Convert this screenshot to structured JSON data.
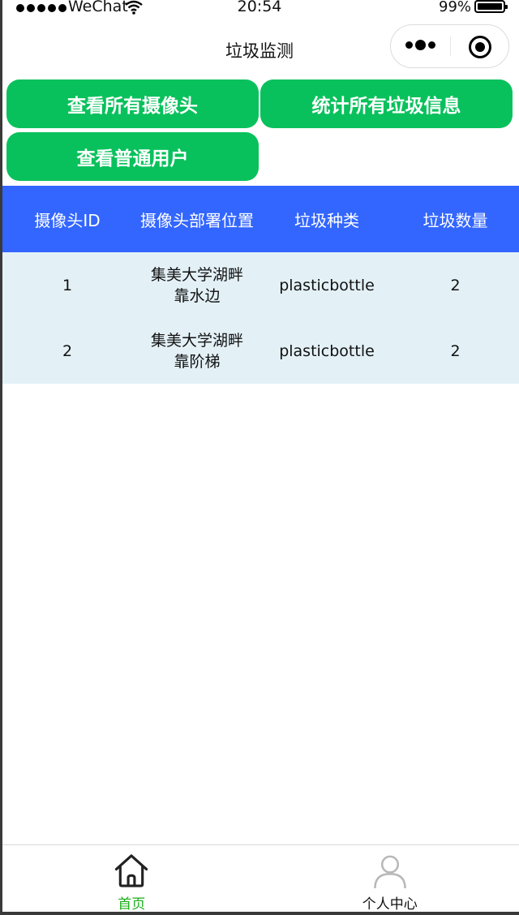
{
  "status_bar": {
    "carrier": "WeChat",
    "time": "20:54",
    "battery": "99%"
  },
  "nav": {
    "title": "垃圾监测"
  },
  "actions": {
    "view_cameras": "查看所有摄像头",
    "stats_garbage": "统计所有垃圾信息",
    "view_users": "查看普通用户"
  },
  "table": {
    "headers": [
      "摄像头ID",
      "摄像头部署位置",
      "垃圾种类",
      "垃圾数量"
    ],
    "rows": [
      [
        "1",
        "集美大学湖畔靠水边",
        "plasticbottle",
        "2"
      ],
      [
        "2",
        "集美大学湖畔靠阶梯",
        "plasticbottle",
        "2"
      ]
    ]
  },
  "tabbar": {
    "home": "首页",
    "me": "个人中心"
  },
  "colors": {
    "primary_green": "#09c15c",
    "header_blue": "#3366ff",
    "row_bg": "#e3f1f7",
    "active_tab": "#1aad19"
  }
}
